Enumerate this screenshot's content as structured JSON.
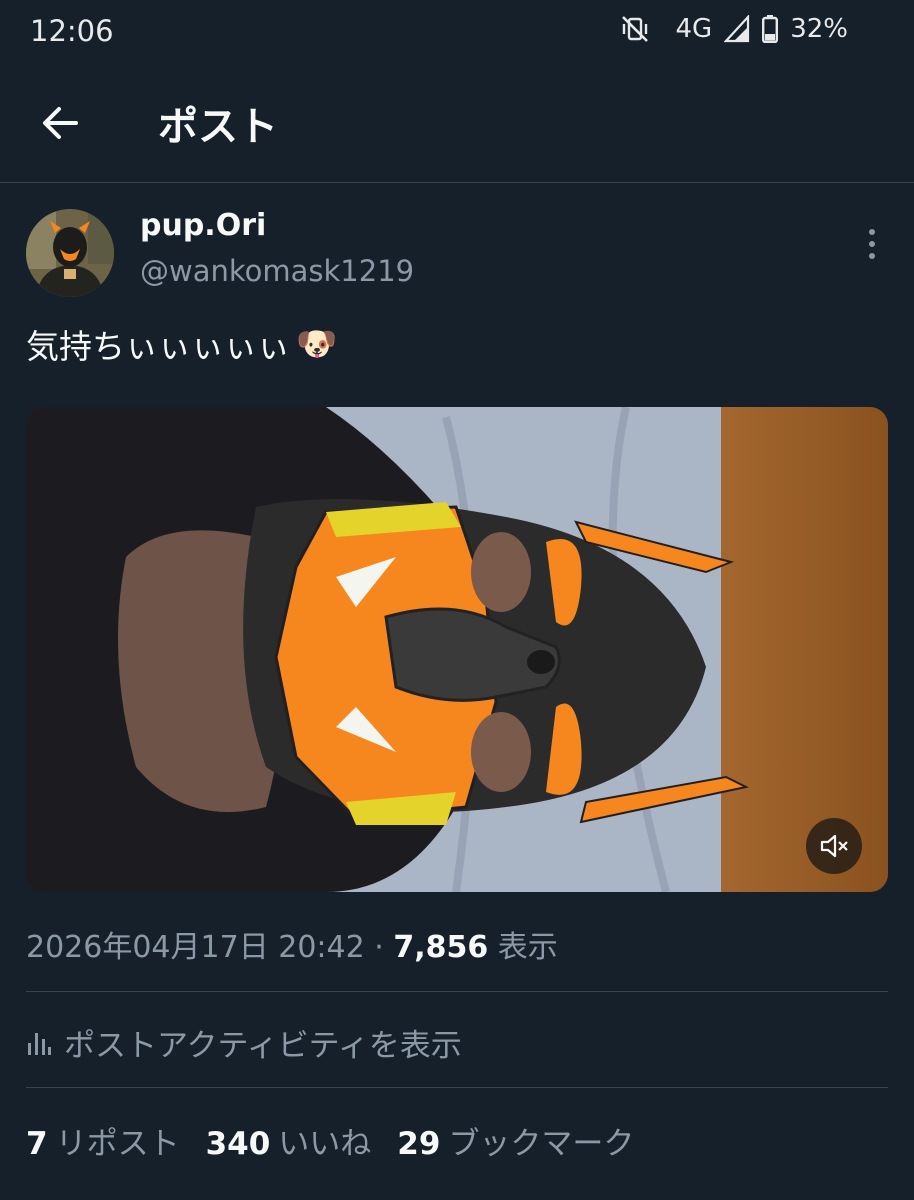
{
  "status_bar": {
    "time": "12:06",
    "network": "4G",
    "battery": "32%"
  },
  "header": {
    "title": "ポスト"
  },
  "post": {
    "display_name": "pup.Ori",
    "handle": "@wankomask1219",
    "text": "気持ちぃぃぃぃぃ",
    "emoji": "🐶",
    "timestamp": "2026年04月17日 20:42",
    "separator": "·",
    "views": "7,856",
    "views_label": "表示",
    "activity_label": "ポストアクティビティを表示",
    "reposts": "7",
    "reposts_label": "リポスト",
    "likes": "340",
    "likes_label": "いいね",
    "bookmarks": "29",
    "bookmarks_label": "ブックマーク"
  },
  "colors": {
    "background": "#15202b",
    "text": "#f7f9f9",
    "secondary": "#8b98a5",
    "divider": "#38444d",
    "mask_orange": "#f6871f"
  },
  "icons": [
    "vibrate-off-icon",
    "signal-icon",
    "battery-icon",
    "back-arrow-icon",
    "more-vertical-icon",
    "mute-icon",
    "bar-chart-icon"
  ]
}
